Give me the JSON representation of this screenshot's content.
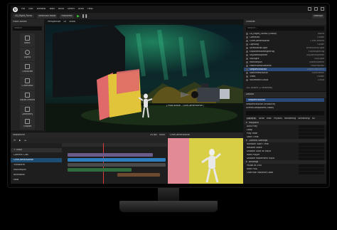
{
  "editor": {
    "logo": "U",
    "menu": [
      "File",
      "Edit",
      "Window",
      "Tools",
      "Build",
      "Select",
      "Actor",
      "Help"
    ],
    "level_tab": "L8_Night_Fores",
    "toolbar": [
      "Selection Mode",
      "Platforms"
    ],
    "settings_label": "Settings"
  },
  "modes_panel": {
    "title": "Place Actors",
    "search_placeholder": "Search",
    "tools": [
      "Basic",
      "Lights",
      "Character",
      "Cinematic",
      "Visual Effects",
      "Geometry",
      "Shapes",
      "All Classes"
    ]
  },
  "viewport": {
    "tabs": [
      "Perspective",
      "Lit",
      "Show"
    ],
    "pilot_label": "[ Pilot Active - CineCameraActor ]"
  },
  "outliner": {
    "title": "Outliner",
    "search_placeholder": "Search...",
    "rows": [
      {
        "label": "L8_Night_Forest (Editor)",
        "type": "World"
      },
      {
        "label": "Cameras",
        "type": "Folder"
      },
      {
        "label": "CineCameraActor",
        "type": "CineCamera"
      },
      {
        "label": "Lighting",
        "type": "Folder"
      },
      {
        "label": "DirectionalLight",
        "type": "DirectionalLight"
      },
      {
        "label": "ExponentialHeightFog",
        "type": "ExpHeightFog"
      },
      {
        "label": "SkyAtmosphere",
        "type": "SkyAtmosphere"
      },
      {
        "label": "SkyLight",
        "type": "SkyLight"
      },
      {
        "label": "Mannequin",
        "type": "SkeletalMesh"
      },
      {
        "label": "PostProcessVolume",
        "type": "PostProcess"
      },
      {
        "label": "SequenceActor",
        "type": "LevelSequence"
      },
      {
        "label": "StaticMeshActor",
        "type": "StaticMesh"
      },
      {
        "label": "Trees",
        "type": "Folder"
      },
      {
        "label": "VolumetricCloud",
        "type": "Cloud"
      }
    ],
    "selected_index": 10,
    "footer": "341 actors (1 selected)"
  },
  "details": {
    "title": "Details",
    "selected_actor": "SequenceActor",
    "components": [
      "SequenceActor (Instance)",
      "SceneComponent (Root)"
    ],
    "tabs": [
      "General",
      "Actor",
      "Misc",
      "Physics",
      "Rendering",
      "Streaming",
      "All"
    ],
    "sections": [
      "Playback",
      "Camera Settings",
      "Bindings"
    ],
    "props": [
      "Auto Play",
      "Loop",
      "Play Rate",
      "Start Time",
      "Random Start Time",
      "Restore State",
      "Disable Look At Input",
      "Hide Player",
      "Disable Movement Input",
      "Pause at End",
      "Hide HUD",
      "Override Instance Data"
    ]
  },
  "sequencer": {
    "title": "Sequencer",
    "fps": "24 fps",
    "time": "0000",
    "tracks": [
      "+ Track",
      "Camera Cuts",
      "CineCameraActor",
      "Transform",
      "Mannequin",
      "Animation",
      "Fade"
    ]
  },
  "camera_preview": {
    "title": "CineCameraActor"
  }
}
